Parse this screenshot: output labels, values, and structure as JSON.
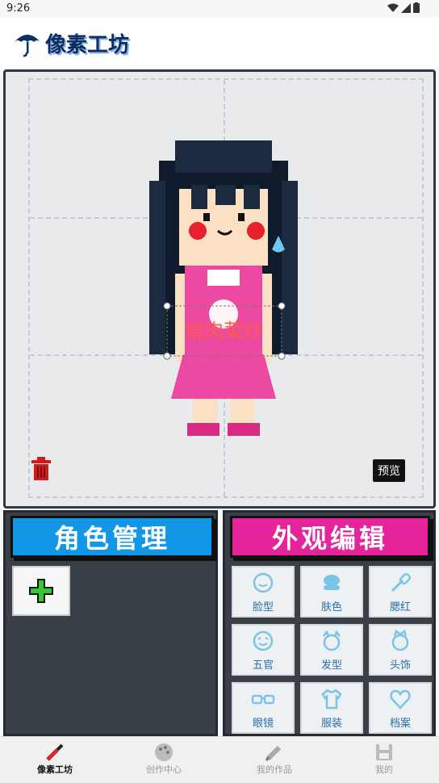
{
  "status_bar": {
    "time": "9:26"
  },
  "header": {
    "app_title": "像素工坊"
  },
  "canvas": {
    "sticker_text": "烧肉菜炒",
    "preview_label": "预览"
  },
  "left_panel": {
    "title": "角色管理"
  },
  "right_panel": {
    "title": "外观编辑",
    "items": [
      {
        "label": "脸型",
        "icon": "face-icon"
      },
      {
        "label": "肤色",
        "icon": "skin-color-icon"
      },
      {
        "label": "腮红",
        "icon": "blush-brush-icon"
      },
      {
        "label": "五官",
        "icon": "features-icon"
      },
      {
        "label": "发型",
        "icon": "hairstyle-icon"
      },
      {
        "label": "头饰",
        "icon": "headwear-icon"
      },
      {
        "label": "眼镜",
        "icon": "glasses-icon"
      },
      {
        "label": "服装",
        "icon": "clothing-icon"
      },
      {
        "label": "档案",
        "icon": "heart-icon"
      }
    ]
  },
  "tabbar": {
    "tabs": [
      {
        "label": "像素工坊",
        "active": true
      },
      {
        "label": "创作中心",
        "active": false
      },
      {
        "label": "我的作品",
        "active": false
      },
      {
        "label": "我的",
        "active": false
      }
    ]
  },
  "colors": {
    "accent_blue": "#1296e6",
    "accent_pink": "#e5239b",
    "panel_bg": "#3a4048"
  }
}
